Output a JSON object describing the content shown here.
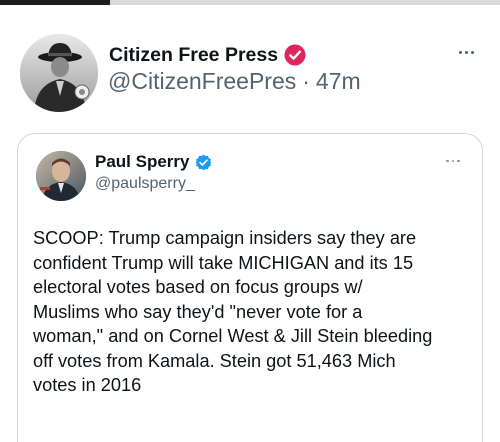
{
  "progress": {
    "fraction": 0.22
  },
  "tweet": {
    "author": {
      "name": "Citizen Free Press",
      "handle": "@CitizenFreePres",
      "separator": "·",
      "time": "47m",
      "verified_color": "#e0245e",
      "avatar_icon": "fedora-man-portrait"
    },
    "more_icon": "more-horizontal-icon"
  },
  "quote": {
    "author": {
      "name": "Paul Sperry",
      "handle": "@paulsperry_",
      "verified_color": "#1d9bf0",
      "avatar_icon": "man-portrait"
    },
    "text": "SCOOP: Trump campaign insiders say they are\nconfident Trump will take MICHIGAN and its 15\nelectoral votes based on focus groups w/\nMuslims who say they'd \"never vote for a\nwoman,\" and on Cornel West & Jill Stein bleeding\noff votes from Kamala. Stein got 51,463 Mich\nvotes in 2016"
  }
}
